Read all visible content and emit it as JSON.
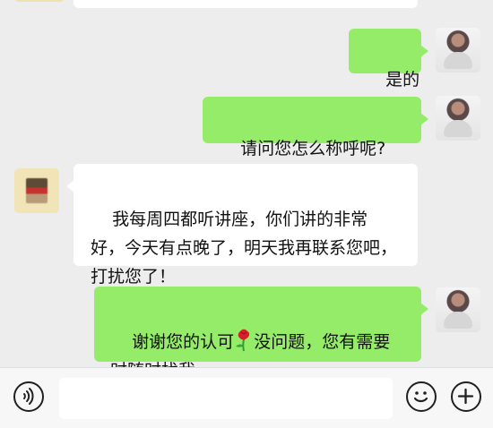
{
  "messages": [
    {
      "text": "是的"
    },
    {
      "text": "请问您怎么称呼呢?"
    },
    {
      "text": "我每周四都听讲座，你们讲的非常好，今天有点晚了，明天我再联系您吧，打扰您了！"
    },
    {
      "text_before": "谢谢您的认可",
      "text_after": "没问题，您有需要时随时找我"
    }
  ],
  "icons": {
    "voice": "voice-icon",
    "emoji": "emoji-icon",
    "plus": "plus-icon",
    "rose": "rose-emoji"
  },
  "colors": {
    "chat_background": "#ededed",
    "incoming_bubble": "#ffffff",
    "outgoing_bubble": "#95ec69",
    "input_bar": "#f7f7f7"
  }
}
